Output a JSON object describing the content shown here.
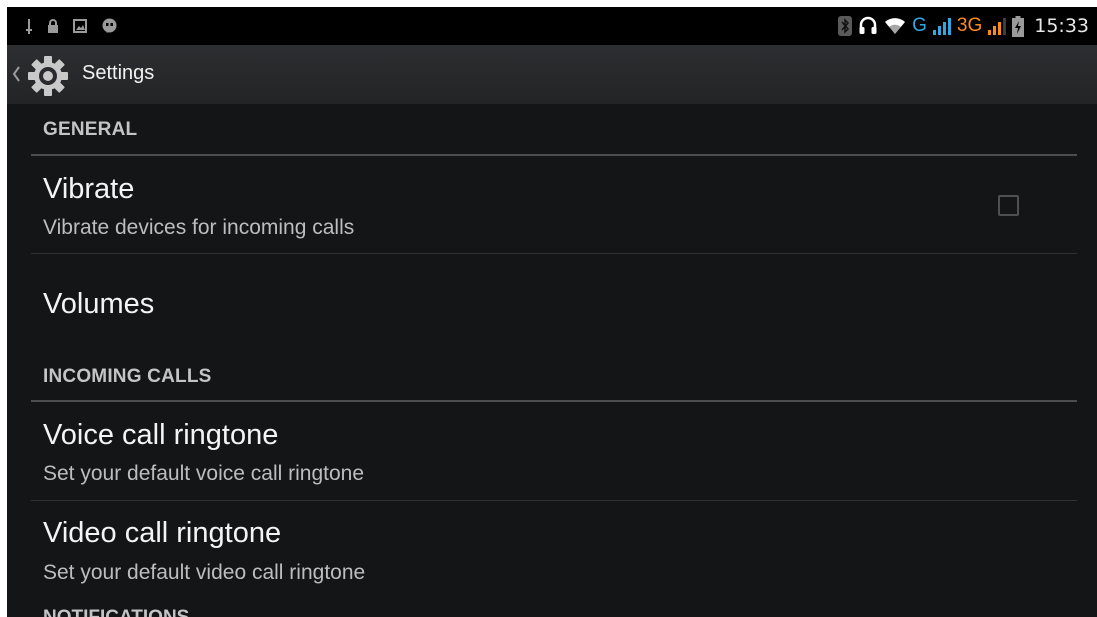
{
  "status_bar": {
    "time": "15:33",
    "network_g": "G",
    "network_3g": "3G",
    "left_icons": [
      "usb-debug-icon",
      "lock-icon",
      "gallery-icon",
      "talk-icon"
    ],
    "right_icons": [
      "bluetooth-icon",
      "headset-icon",
      "wifi-icon",
      "signal-icon",
      "signal-icon",
      "battery-icon"
    ]
  },
  "action_bar": {
    "title": "Settings",
    "icon": "gear-icon"
  },
  "sections": [
    {
      "title": "GENERAL",
      "items": [
        {
          "title": "Vibrate",
          "summary": "Vibrate devices for incoming calls",
          "checked": false
        },
        {
          "title": "Volumes"
        }
      ]
    },
    {
      "title": "INCOMING CALLS",
      "items": [
        {
          "title": "Voice call ringtone",
          "summary": "Set your default voice call ringtone"
        },
        {
          "title": "Video call ringtone",
          "summary": "Set your default video call ringtone"
        }
      ]
    },
    {
      "title": "NOTIFICATIONS"
    }
  ],
  "colors": {
    "background": "#141517",
    "accent_g": "#34a6e0",
    "accent_3g": "#ff8a1c"
  }
}
